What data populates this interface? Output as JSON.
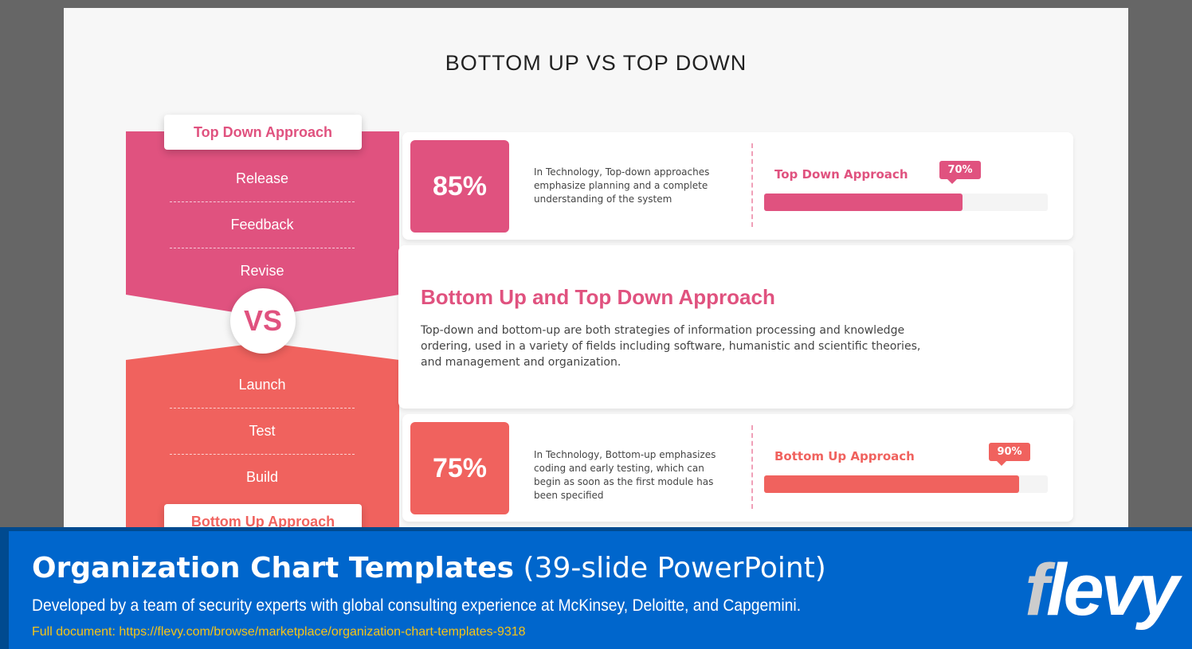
{
  "slide": {
    "title": "BOTTOM UP VS TOP DOWN",
    "colors": {
      "pink": "#e0527f",
      "coral": "#f0625e"
    },
    "left": {
      "top_tag": "Top Down Approach",
      "top_steps": [
        "Release",
        "Feedback",
        "Revise"
      ],
      "vs": "VS",
      "bottom_steps": [
        "Launch",
        "Test",
        "Build"
      ],
      "bottom_tag": "Bottom Up Approach"
    },
    "top_card": {
      "percent": "85%",
      "description": "In Technology, Top-down approaches emphasize planning and a complete understanding of the system",
      "bar_label": "Top Down Approach",
      "bar_value": "70%",
      "bar_fill": 70
    },
    "middle_card": {
      "heading": "Bottom Up and Top Down Approach",
      "body": "Top-down and bottom-up are both strategies of information processing and knowledge ordering, used in a variety of fields including software, humanistic and scientific theories, and management and organization."
    },
    "bottom_card": {
      "percent": "75%",
      "description": "In Technology, Bottom-up emphasizes coding and early testing, which can begin as soon as the first module has been specified",
      "bar_label": "Bottom Up Approach",
      "bar_value": "90%",
      "bar_fill": 90
    }
  },
  "banner": {
    "title_bold": "Organization Chart Templates",
    "title_light": "(39-slide PowerPoint)",
    "subtitle": "Developed by a team of security experts with global consulting experience at McKinsey, Deloitte, and Capgemini.",
    "link": "Full document: https://flevy.com/browse/marketplace/organization-chart-templates-9318",
    "logo": "flevy"
  }
}
